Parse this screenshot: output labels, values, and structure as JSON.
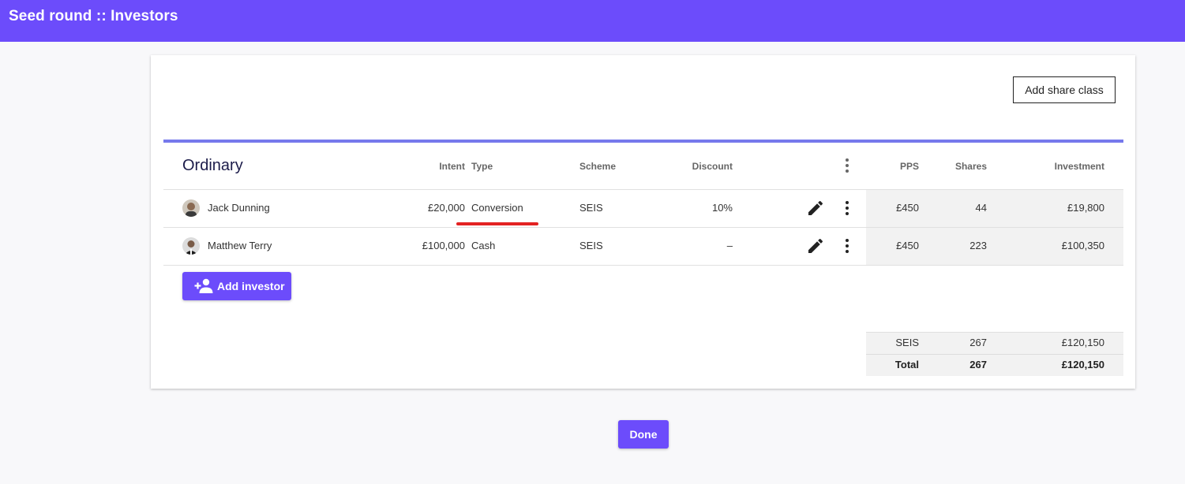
{
  "app": {
    "title": "Seed round  ::  Investors"
  },
  "toolbar": {
    "add_share_class_label": "Add share class"
  },
  "share_class": {
    "name": "Ordinary",
    "columns": {
      "intent": "Intent",
      "type": "Type",
      "scheme": "Scheme",
      "discount": "Discount",
      "pps": "PPS",
      "shares": "Shares",
      "investment": "Investment"
    },
    "investors": [
      {
        "name": "Jack Dunning",
        "intent": "£20,000",
        "type": "Conversion",
        "scheme": "SEIS",
        "discount": "10%",
        "pps": "£450",
        "shares": "44",
        "investment": "£19,800"
      },
      {
        "name": "Matthew Terry",
        "intent": "£100,000",
        "type": "Cash",
        "scheme": "SEIS",
        "discount": "–",
        "pps": "£450",
        "shares": "223",
        "investment": "£100,350"
      }
    ],
    "add_investor_label": "Add investor",
    "summary": [
      {
        "label": "SEIS",
        "shares": "267",
        "investment": "£120,150"
      },
      {
        "label": "Total",
        "shares": "267",
        "investment": "£120,150"
      }
    ]
  },
  "footer": {
    "done_label": "Done"
  },
  "colors": {
    "brand": "#6c4cfb",
    "accent_rule": "#7679ec",
    "highlight": "#e32222"
  }
}
